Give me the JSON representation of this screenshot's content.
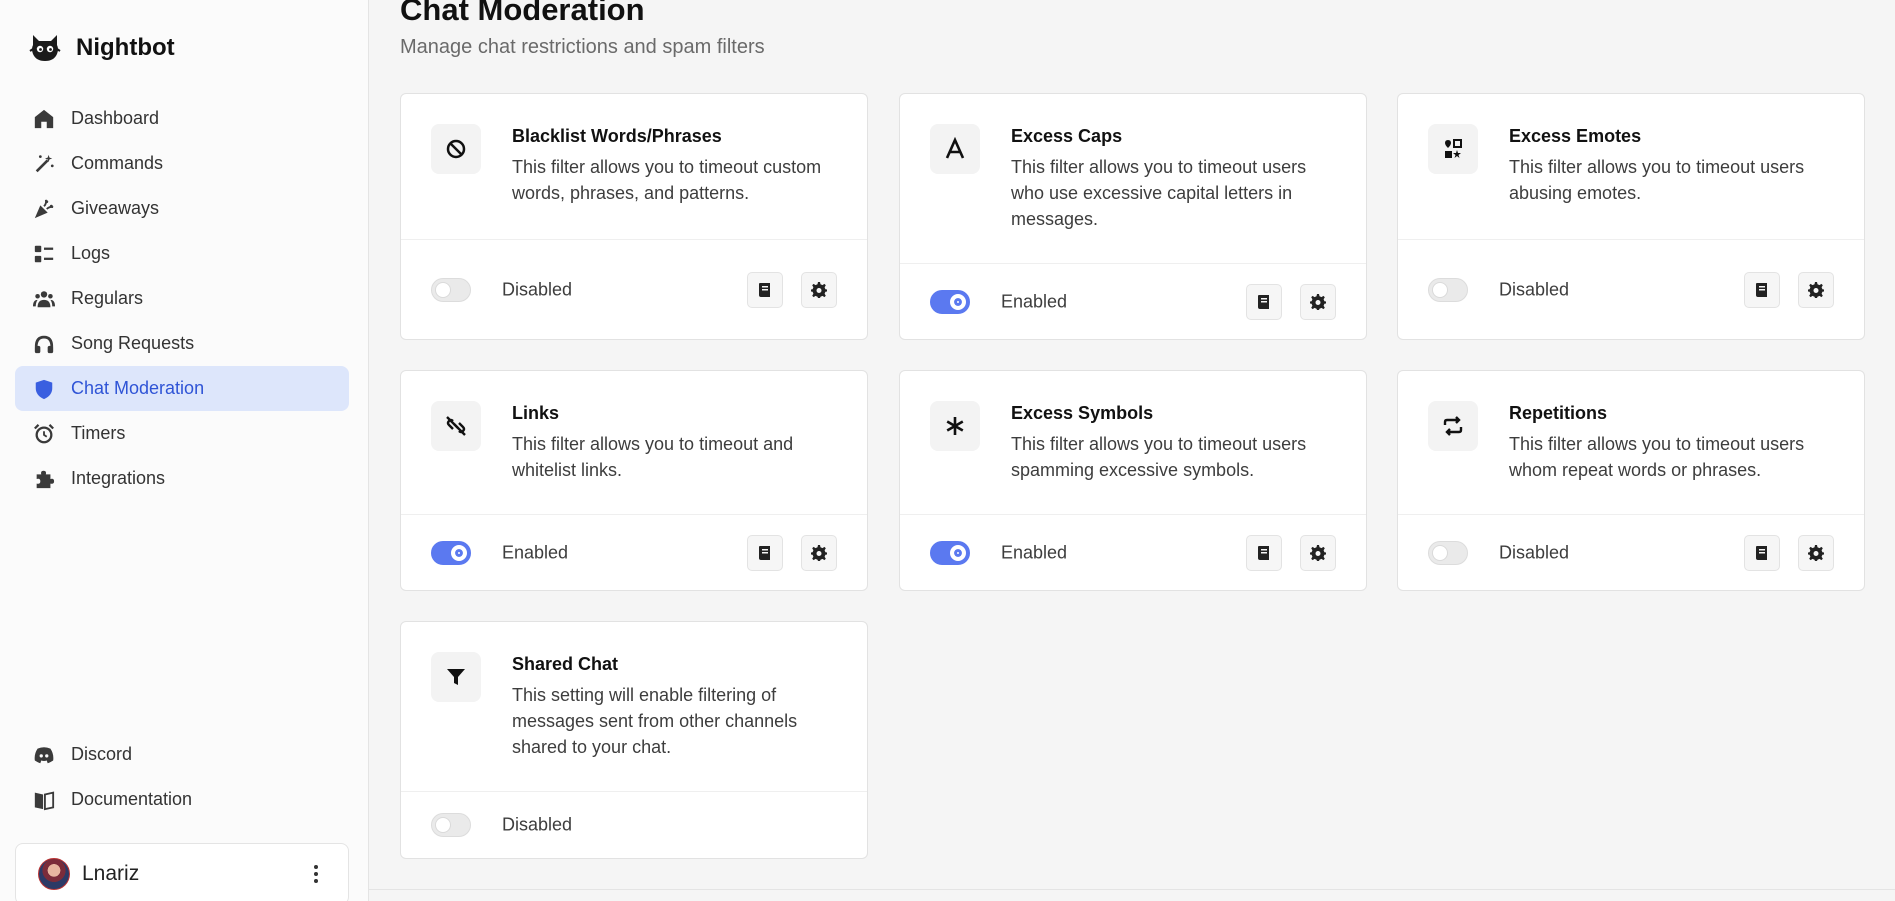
{
  "brand": {
    "name": "Nightbot"
  },
  "sidebar": {
    "items": [
      {
        "label": "Dashboard",
        "icon": "home-icon"
      },
      {
        "label": "Commands",
        "icon": "magic-wand-icon"
      },
      {
        "label": "Giveaways",
        "icon": "party-popper-icon"
      },
      {
        "label": "Logs",
        "icon": "list-icon"
      },
      {
        "label": "Regulars",
        "icon": "users-icon"
      },
      {
        "label": "Song Requests",
        "icon": "headphones-icon"
      },
      {
        "label": "Chat Moderation",
        "icon": "shield-icon",
        "active": true
      },
      {
        "label": "Timers",
        "icon": "alarm-clock-icon"
      },
      {
        "label": "Integrations",
        "icon": "puzzle-icon"
      }
    ],
    "bottom": [
      {
        "label": "Discord",
        "icon": "discord-icon"
      },
      {
        "label": "Documentation",
        "icon": "book-open-icon"
      }
    ],
    "user": {
      "name": "Lnariz"
    }
  },
  "page": {
    "title": "Chat Moderation",
    "subtitle": "Manage chat restrictions and spam filters"
  },
  "filters": [
    {
      "title": "Blacklist Words/Phrases",
      "description": "This filter allows you to timeout custom words, phrases, and patterns.",
      "status": "Disabled",
      "enabled": false,
      "icon": "ban-icon"
    },
    {
      "title": "Excess Caps",
      "description": "This filter allows you to timeout users who use excessive capital letters in messages.",
      "status": "Enabled",
      "enabled": true,
      "icon": "letter-a-icon"
    },
    {
      "title": "Excess Emotes",
      "description": "This filter allows you to timeout users abusing emotes.",
      "status": "Disabled",
      "enabled": false,
      "icon": "icons-icon"
    },
    {
      "title": "Links",
      "description": "This filter allows you to timeout and whitelist links.",
      "status": "Enabled",
      "enabled": true,
      "icon": "link-slash-icon"
    },
    {
      "title": "Excess Symbols",
      "description": "This filter allows you to timeout users spamming excessive symbols.",
      "status": "Enabled",
      "enabled": true,
      "icon": "asterisk-icon"
    },
    {
      "title": "Repetitions",
      "description": "This filter allows you to timeout users whom repeat words or phrases.",
      "status": "Disabled",
      "enabled": false,
      "icon": "repeat-icon"
    },
    {
      "title": "Shared Chat",
      "description": "This setting will enable filtering of messages sent from other channels shared to your chat.",
      "status": "Disabled",
      "enabled": false,
      "icon": "filter-icon"
    }
  ],
  "colors": {
    "accent": "#5b79f0",
    "active_nav_bg": "#dde6fb",
    "active_nav_text": "#2f54d6"
  }
}
